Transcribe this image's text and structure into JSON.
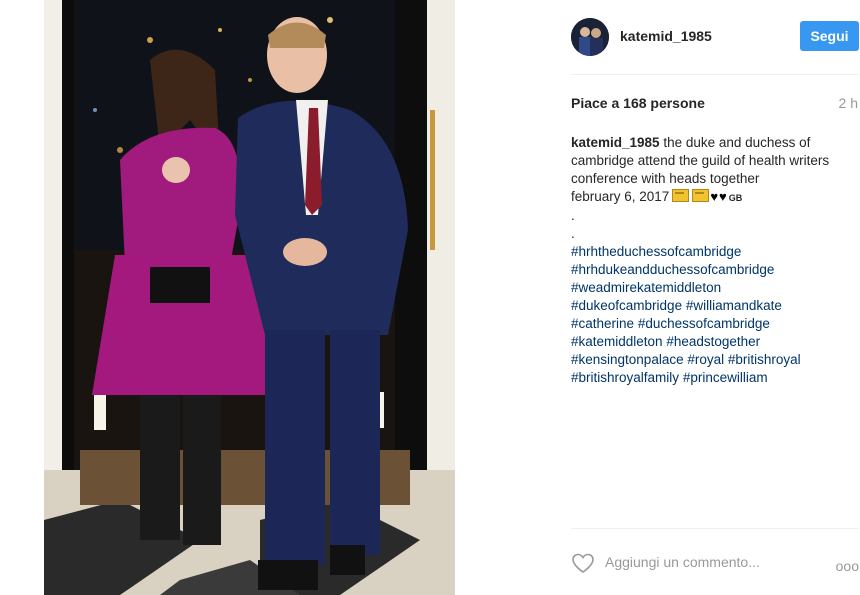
{
  "post": {
    "username": "katemid_1985",
    "follow_label": "Segui",
    "likes_text": "Piace a 168 persone",
    "time_ago": "2 h",
    "caption": {
      "username": "katemid_1985",
      "text_lines": [
        "the duke and duchess of",
        "cambridge attend the guild of health writers",
        "conference with heads together"
      ],
      "date_line": "february 6, 2017",
      "emoji_suffix": "GB",
      "dots": [
        ".",
        "."
      ],
      "hashtags": [
        [
          "#hrhtheduchessofcambridge"
        ],
        [
          "#hrhdukeandduchessofcambridge"
        ],
        [
          "#weadmirekatemiddleton"
        ],
        [
          "#dukeofcambridge",
          "#williamandkate"
        ],
        [
          "#catherine",
          "#duchessofcambridge"
        ],
        [
          "#katemiddleton",
          "#headstogether"
        ],
        [
          "#kensingtonpalace",
          "#royal",
          "#britishroyal"
        ],
        [
          "#britishroyalfamily",
          "#princewilliam"
        ]
      ]
    },
    "comment_placeholder": "Aggiungi un commento...",
    "more_label": "ooo"
  },
  "colors": {
    "follow_button": "#3897f0",
    "hashtag": "#003569",
    "muted": "#999999",
    "text": "#262626"
  },
  "icons": [
    "heart-outline-icon",
    "more-options-icon"
  ]
}
